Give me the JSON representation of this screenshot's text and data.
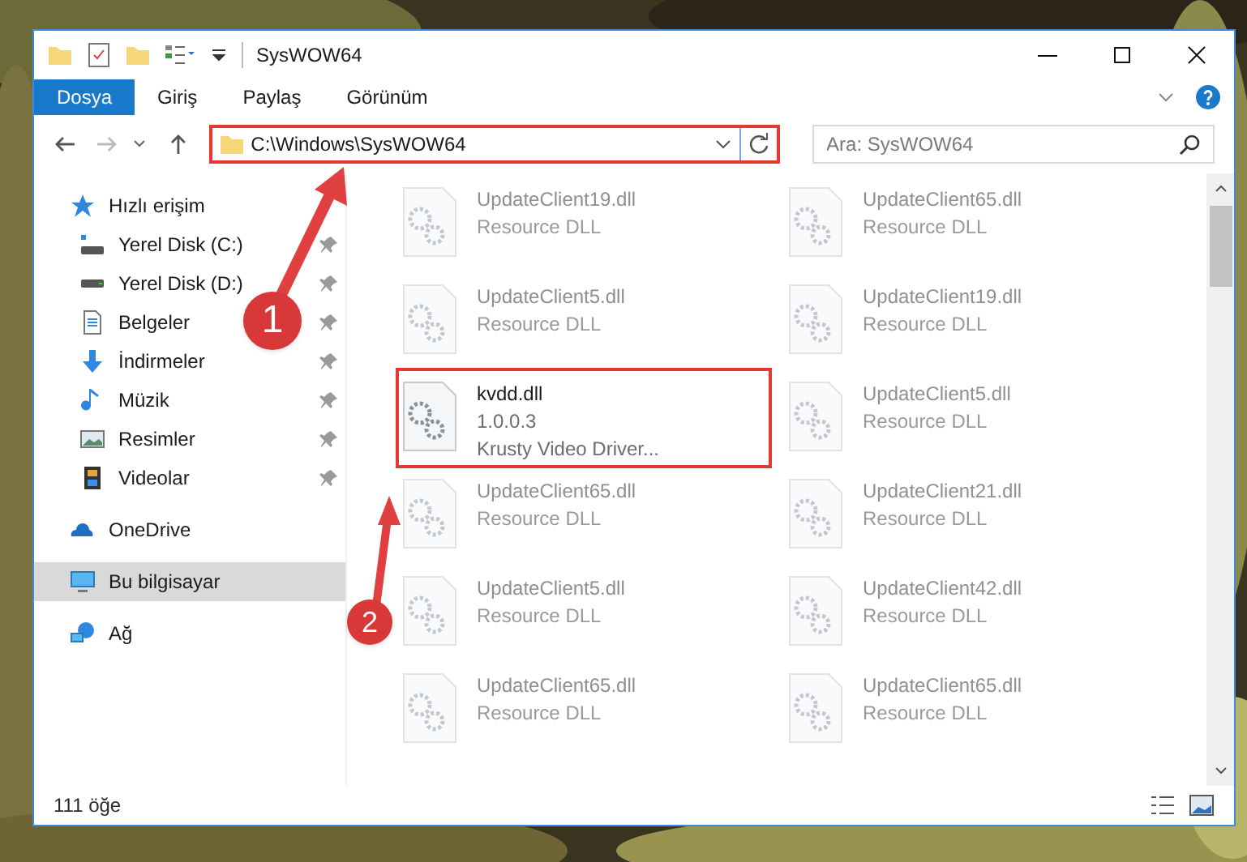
{
  "window": {
    "title": "SysWOW64"
  },
  "ribbon_tabs": [
    {
      "label": "Dosya",
      "selected": true
    },
    {
      "label": "Giriş",
      "selected": false
    },
    {
      "label": "Paylaş",
      "selected": false
    },
    {
      "label": "Görünüm",
      "selected": false
    }
  ],
  "address_bar": {
    "path": "C:\\Windows\\SysWOW64",
    "highlighted": true
  },
  "search": {
    "placeholder": "Ara: SysWOW64"
  },
  "sidebar": {
    "items": [
      {
        "label": "Hızlı erişim",
        "kind": "star",
        "selected": false,
        "children": [
          {
            "label": "Yerel Disk (C:)",
            "kind": "disk-c",
            "pinned": true,
            "selected": false
          },
          {
            "label": "Yerel Disk (D:)",
            "kind": "disk",
            "pinned": true,
            "selected": false
          },
          {
            "label": "Belgeler",
            "kind": "docs",
            "pinned": true,
            "selected": false
          },
          {
            "label": "İndirmeler",
            "kind": "download",
            "pinned": true,
            "selected": false
          },
          {
            "label": "Müzik",
            "kind": "music",
            "pinned": true,
            "selected": false
          },
          {
            "label": "Resimler",
            "kind": "pictures",
            "pinned": true,
            "selected": false
          },
          {
            "label": "Videolar",
            "kind": "videos",
            "pinned": true,
            "selected": false
          }
        ]
      },
      {
        "label": "OneDrive",
        "kind": "cloud",
        "selected": false
      },
      {
        "label": "Bu bilgisayar",
        "kind": "pc",
        "selected": true
      },
      {
        "label": "Ağ",
        "kind": "network",
        "selected": false
      }
    ]
  },
  "files": [
    {
      "name": "UpdateClient19.dll",
      "lines": [
        "Resource DLL"
      ],
      "blurred": true,
      "highlighted": false
    },
    {
      "name": "UpdateClient65.dll",
      "lines": [
        "Resource DLL"
      ],
      "blurred": true,
      "highlighted": false
    },
    {
      "name": "UpdateClient5.dll",
      "lines": [
        "Resource DLL"
      ],
      "blurred": true,
      "highlighted": false
    },
    {
      "name": "UpdateClient19.dll",
      "lines": [
        "Resource DLL"
      ],
      "blurred": true,
      "highlighted": false
    },
    {
      "name": "kvdd.dll",
      "lines": [
        "1.0.0.3",
        "Krusty Video Driver..."
      ],
      "blurred": false,
      "highlighted": true
    },
    {
      "name": "UpdateClient5.dll",
      "lines": [
        "Resource DLL"
      ],
      "blurred": true,
      "highlighted": false
    },
    {
      "name": "UpdateClient65.dll",
      "lines": [
        "Resource DLL"
      ],
      "blurred": true,
      "highlighted": false
    },
    {
      "name": "UpdateClient21.dll",
      "lines": [
        "Resource DLL"
      ],
      "blurred": true,
      "highlighted": false
    },
    {
      "name": "UpdateClient5.dll",
      "lines": [
        "Resource DLL"
      ],
      "blurred": true,
      "highlighted": false
    },
    {
      "name": "UpdateClient42.dll",
      "lines": [
        "Resource DLL"
      ],
      "blurred": true,
      "highlighted": false
    },
    {
      "name": "UpdateClient65.dll",
      "lines": [
        "Resource DLL"
      ],
      "blurred": true,
      "highlighted": false
    },
    {
      "name": "UpdateClient65.dll",
      "lines": [
        "Resource DLL"
      ],
      "blurred": true,
      "highlighted": false
    }
  ],
  "status_bar": {
    "count": "111 öğe"
  },
  "callouts": [
    {
      "label": "1"
    },
    {
      "label": "2"
    }
  ]
}
